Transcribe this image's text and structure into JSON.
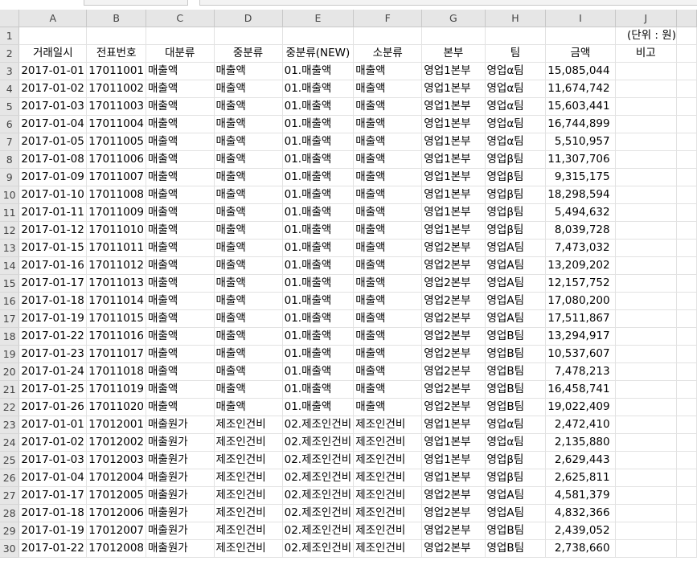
{
  "columns": [
    "A",
    "B",
    "C",
    "D",
    "E",
    "F",
    "G",
    "H",
    "I",
    "J"
  ],
  "row_numbers": [
    1,
    2,
    3,
    4,
    5,
    6,
    7,
    8,
    9,
    10,
    11,
    12,
    13,
    14,
    15,
    16,
    17,
    18,
    19,
    20,
    21,
    22,
    23,
    24,
    25,
    26,
    27,
    28,
    29,
    30
  ],
  "unit_note": "(단위 : 원)",
  "headers": [
    "거래일시",
    "전표번호",
    "대분류",
    "중분류",
    "중분류(NEW)",
    "소분류",
    "본부",
    "팀",
    "금액",
    "비고"
  ],
  "rows": [
    [
      "2017-01-01",
      "17011001",
      "매출액",
      "매출액",
      "01.매출액",
      "매출액",
      "영업1본부",
      "영업α팀",
      "15,085,044",
      ""
    ],
    [
      "2017-01-02",
      "17011002",
      "매출액",
      "매출액",
      "01.매출액",
      "매출액",
      "영업1본부",
      "영업α팀",
      "11,674,742",
      ""
    ],
    [
      "2017-01-03",
      "17011003",
      "매출액",
      "매출액",
      "01.매출액",
      "매출액",
      "영업1본부",
      "영업α팀",
      "15,603,441",
      ""
    ],
    [
      "2017-01-04",
      "17011004",
      "매출액",
      "매출액",
      "01.매출액",
      "매출액",
      "영업1본부",
      "영업α팀",
      "16,744,899",
      ""
    ],
    [
      "2017-01-05",
      "17011005",
      "매출액",
      "매출액",
      "01.매출액",
      "매출액",
      "영업1본부",
      "영업α팀",
      "5,510,957",
      ""
    ],
    [
      "2017-01-08",
      "17011006",
      "매출액",
      "매출액",
      "01.매출액",
      "매출액",
      "영업1본부",
      "영업β팀",
      "11,307,706",
      ""
    ],
    [
      "2017-01-09",
      "17011007",
      "매출액",
      "매출액",
      "01.매출액",
      "매출액",
      "영업1본부",
      "영업β팀",
      "9,315,175",
      ""
    ],
    [
      "2017-01-10",
      "17011008",
      "매출액",
      "매출액",
      "01.매출액",
      "매출액",
      "영업1본부",
      "영업β팀",
      "18,298,594",
      ""
    ],
    [
      "2017-01-11",
      "17011009",
      "매출액",
      "매출액",
      "01.매출액",
      "매출액",
      "영업1본부",
      "영업β팀",
      "5,494,632",
      ""
    ],
    [
      "2017-01-12",
      "17011010",
      "매출액",
      "매출액",
      "01.매출액",
      "매출액",
      "영업1본부",
      "영업β팀",
      "8,039,728",
      ""
    ],
    [
      "2017-01-15",
      "17011011",
      "매출액",
      "매출액",
      "01.매출액",
      "매출액",
      "영업2본부",
      "영업A팀",
      "7,473,032",
      ""
    ],
    [
      "2017-01-16",
      "17011012",
      "매출액",
      "매출액",
      "01.매출액",
      "매출액",
      "영업2본부",
      "영업A팀",
      "13,209,202",
      ""
    ],
    [
      "2017-01-17",
      "17011013",
      "매출액",
      "매출액",
      "01.매출액",
      "매출액",
      "영업2본부",
      "영업A팀",
      "12,157,752",
      ""
    ],
    [
      "2017-01-18",
      "17011014",
      "매출액",
      "매출액",
      "01.매출액",
      "매출액",
      "영업2본부",
      "영업A팀",
      "17,080,200",
      ""
    ],
    [
      "2017-01-19",
      "17011015",
      "매출액",
      "매출액",
      "01.매출액",
      "매출액",
      "영업2본부",
      "영업A팀",
      "17,511,867",
      ""
    ],
    [
      "2017-01-22",
      "17011016",
      "매출액",
      "매출액",
      "01.매출액",
      "매출액",
      "영업2본부",
      "영업B팀",
      "13,294,917",
      ""
    ],
    [
      "2017-01-23",
      "17011017",
      "매출액",
      "매출액",
      "01.매출액",
      "매출액",
      "영업2본부",
      "영업B팀",
      "10,537,607",
      ""
    ],
    [
      "2017-01-24",
      "17011018",
      "매출액",
      "매출액",
      "01.매출액",
      "매출액",
      "영업2본부",
      "영업B팀",
      "7,478,213",
      ""
    ],
    [
      "2017-01-25",
      "17011019",
      "매출액",
      "매출액",
      "01.매출액",
      "매출액",
      "영업2본부",
      "영업B팀",
      "16,458,741",
      ""
    ],
    [
      "2017-01-26",
      "17011020",
      "매출액",
      "매출액",
      "01.매출액",
      "매출액",
      "영업2본부",
      "영업B팀",
      "19,022,409",
      ""
    ],
    [
      "2017-01-01",
      "17012001",
      "매출원가",
      "제조인건비",
      "02.제조인건비",
      "제조인건비",
      "영업1본부",
      "영업α팀",
      "2,472,410",
      ""
    ],
    [
      "2017-01-02",
      "17012002",
      "매출원가",
      "제조인건비",
      "02.제조인건비",
      "제조인건비",
      "영업1본부",
      "영업α팀",
      "2,135,880",
      ""
    ],
    [
      "2017-01-03",
      "17012003",
      "매출원가",
      "제조인건비",
      "02.제조인건비",
      "제조인건비",
      "영업1본부",
      "영업β팀",
      "2,629,443",
      ""
    ],
    [
      "2017-01-04",
      "17012004",
      "매출원가",
      "제조인건비",
      "02.제조인건비",
      "제조인건비",
      "영업1본부",
      "영업β팀",
      "2,625,811",
      ""
    ],
    [
      "2017-01-17",
      "17012005",
      "매출원가",
      "제조인건비",
      "02.제조인건비",
      "제조인건비",
      "영업2본부",
      "영업A팀",
      "4,581,379",
      ""
    ],
    [
      "2017-01-18",
      "17012006",
      "매출원가",
      "제조인건비",
      "02.제조인건비",
      "제조인건비",
      "영업2본부",
      "영업A팀",
      "4,832,366",
      ""
    ],
    [
      "2017-01-19",
      "17012007",
      "매출원가",
      "제조인건비",
      "02.제조인건비",
      "제조인건비",
      "영업2본부",
      "영업B팀",
      "2,439,052",
      ""
    ],
    [
      "2017-01-22",
      "17012008",
      "매출원가",
      "제조인건비",
      "02.제조인건비",
      "제조인건비",
      "영업2본부",
      "영업B팀",
      "2,738,660",
      ""
    ]
  ]
}
